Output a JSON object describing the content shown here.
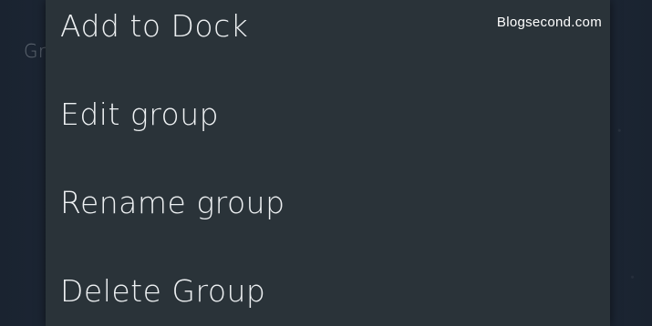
{
  "background": {
    "partial_label": "Gr"
  },
  "menu": {
    "items": [
      {
        "label": "Add to Dock"
      },
      {
        "label": "Edit group"
      },
      {
        "label": "Rename group"
      },
      {
        "label": "Delete Group"
      }
    ]
  },
  "watermark": {
    "text": "Blogsecond.com"
  },
  "colors": {
    "menu_background": "#2a3339",
    "menu_text": "#eef1f3",
    "wallpaper": "#1b2430"
  }
}
